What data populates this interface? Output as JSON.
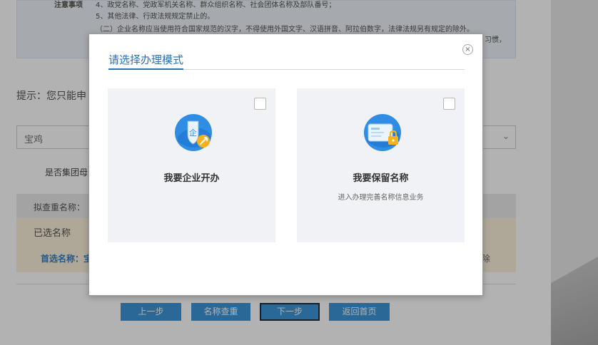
{
  "background": {
    "notice": {
      "title": "注意事项",
      "lines": [
        "4、政党名称、党政军机关名称、群众组织名称、社会团体名称及部队番号；",
        "5、其他法律、行政法规规定禁止的。",
        "（二）企业名称应当使用符合国家规范的汉字，不得使用外国文字、汉语拼音、阿拉伯数字，法律法规另有规定的除外。"
      ],
      "cut_text": "习惯，"
    },
    "hint": "提示：您只能申",
    "region_select": {
      "value": "宝鸡",
      "arrow": "⌄"
    },
    "group_question": "是否集团母",
    "query_label": "拟查重名称：",
    "selected_panel": {
      "title": "已选名称",
      "preferred": "首选名称：宝",
      "remove": "除"
    },
    "buttons": {
      "prev": "上一步",
      "check": "名称查重",
      "next": "下一步",
      "home": "返回首页"
    }
  },
  "modal": {
    "title": "请选择办理模式",
    "close": "×",
    "options": [
      {
        "label": "我要企业开办",
        "subtitle": "",
        "icon": "enterprise-shield-wrench-icon"
      },
      {
        "label": "我要保留名称",
        "subtitle": "进入办理完善名称信息业务",
        "icon": "id-card-lock-icon"
      }
    ]
  },
  "colors": {
    "accent": "#2a6fb7",
    "button_blue": "#3d97d8",
    "card_bg": "#f1f2f6",
    "selected_panel_bg": "#fbf1dc"
  }
}
